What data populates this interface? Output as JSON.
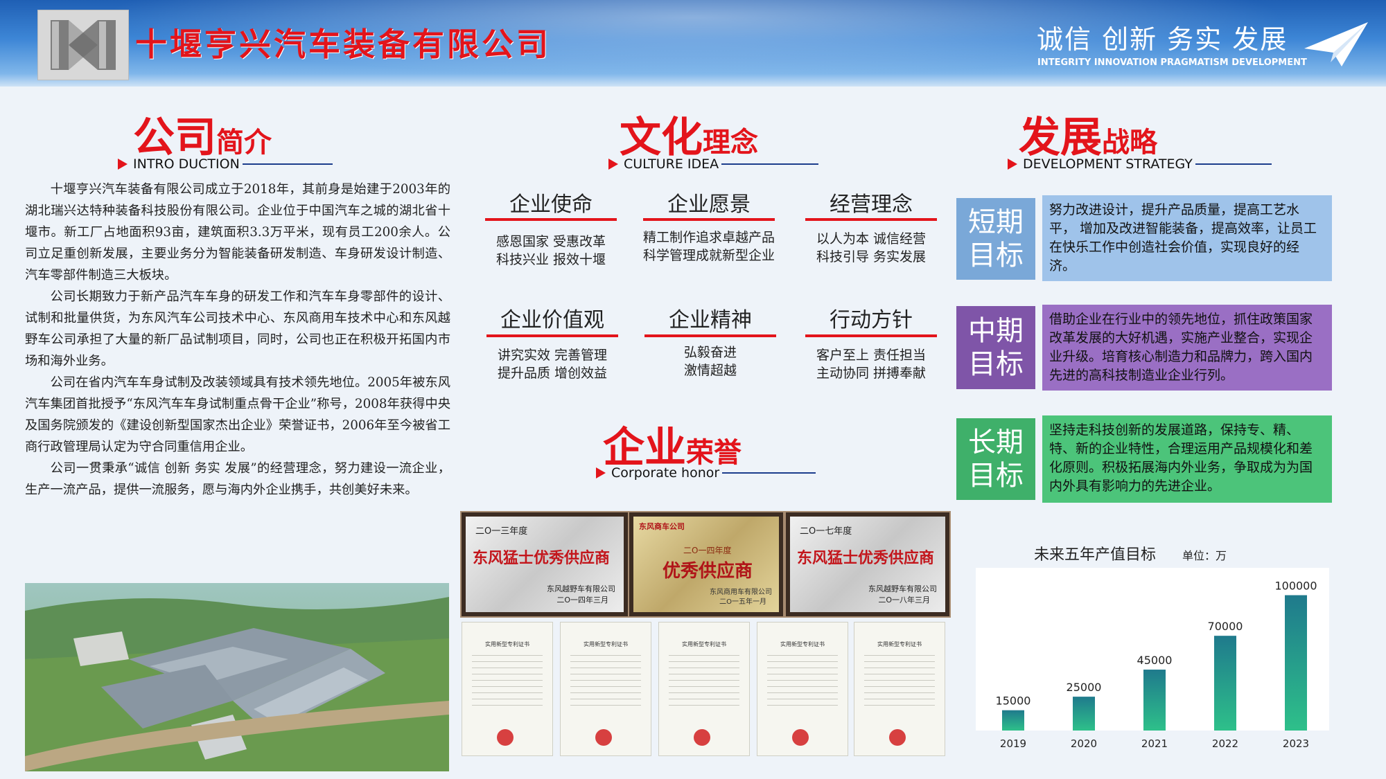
{
  "header": {
    "company_name": "十堰亨兴汽车装备有限公司",
    "motto": "诚信 创新 务实 发展",
    "motto_en": "INTEGRITY INNOVATION PRAGMATISM DEVELOPMENT"
  },
  "intro": {
    "title_big": "公司",
    "title_small": "简介",
    "subtitle": "INTRO DUCTION",
    "paragraphs": [
      "十堰亨兴汽车装备有限公司成立于2018年，其前身是始建于2003年的湖北瑞兴达特种装备科技股份有限公司。企业位于中国汽车之城的湖北省十堰市。新工厂占地面积93亩，建筑面积3.3万平米，现有员工200余人。公司立足重创新发展，主要业务分为智能装备研发制造、车身研发设计制造、汽车零部件制造三大板块。",
      "公司长期致力于新产品汽车车身的研发工作和汽车车身零部件的设计、试制和批量供货，为东风汽车公司技术中心、东风商用车技术中心和东风越野车公司承担了大量的新厂品试制项目，同时，公司也正在积极开拓国内市场和海外业务。",
      "公司在省内汽车车身试制及改装领域具有技术领先地位。2005年被东风汽车集团首批授予“东风汽车车身试制重点骨干企业”称号，2008年获得中央及国务院颁发的《建设创新型国家杰出企业》荣誉证书，2006年至今被省工商行政管理局认定为守合同重信用企业。",
      "公司一贯秉承“诚信 创新 务实 发展”的经营理念，努力建设一流企业，生产一流产品，提供一流服务，愿与海内外企业携手，共创美好未来。"
    ]
  },
  "culture": {
    "title_big": "文化",
    "title_small": "理念",
    "subtitle": "CULTURE IDEA",
    "items": [
      {
        "heading": "企业使命",
        "line1": "感恩国家 受惠改革",
        "line2": "科技兴业 报效十堰"
      },
      {
        "heading": "企业愿景",
        "line1": "精工制作追求卓越产品",
        "line2": "科学管理成就新型企业"
      },
      {
        "heading": "经营理念",
        "line1": "以人为本 诚信经营",
        "line2": "科技引导  务实发展"
      },
      {
        "heading": "企业价值观",
        "line1": "讲究实效  完善管理",
        "line2": "提升品质  增创效益"
      },
      {
        "heading": "企业精神",
        "line1": "弘毅奋进",
        "line2": "激情超越"
      },
      {
        "heading": "行动方针",
        "line1": "客户至上  责任担当",
        "line2": "主动协同  拼搏奉献"
      }
    ]
  },
  "honor": {
    "title_big": "企业",
    "title_small": "荣誉",
    "subtitle": "Corporate honor",
    "plaques": [
      {
        "year": "二O一三年度",
        "title": "东风猛士优秀供应商",
        "org": "东风越野车有限公司",
        "date": "二O一四年三月"
      },
      {
        "year": "二O一四年度",
        "title": "优秀供应商",
        "org": "东风商用车有限公司",
        "date": "二O一五年一月",
        "brand": "东风商车公司"
      },
      {
        "year": "二O一七年度",
        "title": "东风猛士优秀供应商",
        "org": "东风越野车有限公司",
        "date": "二O一八年三月"
      }
    ],
    "cert_title": "实用新型专利证书"
  },
  "strategy": {
    "title_big": "发展",
    "title_small": "战略",
    "subtitle": "DEVELOPMENT STRATEGY",
    "goals": [
      {
        "label_line1": "短期",
        "label_line2": "目标",
        "text": "努力改进设计，提升产品质量，提高工艺水平， 增加及改进智能装备，提高效率，让员工在快乐工作中创造社会价值，实现良好的经济。",
        "label_color": "#7aa8d8",
        "text_bg": "#9fc3ea"
      },
      {
        "label_line1": "中期",
        "label_line2": "目标",
        "text": "借助企业在行业中的领先地位，抓住政策国家改革发展的大好机遇，实施产业整合，实现企业升级。培育核心制造力和品牌力，跨入国内先进的高科技制造业企业行列。",
        "label_color": "#7f55a8",
        "text_bg": "#9a6fc4"
      },
      {
        "label_line1": "长期",
        "label_line2": "目标",
        "text": "坚持走科技创新的发展道路，保持专、精、特、新的企业特性，合理运用产品规模化和差化原则。积极拓展海内外业务，争取成为为国内外具有影响力的先进企业。",
        "label_color": "#3fb06a",
        "text_bg": "#4cc47a"
      }
    ]
  },
  "chart_data": {
    "type": "bar",
    "title": "未来五年产值目标",
    "unit": "单位：万",
    "categories": [
      "2019",
      "2020",
      "2021",
      "2022",
      "2023"
    ],
    "values": [
      15000,
      25000,
      45000,
      70000,
      100000
    ],
    "value_labels": [
      "15000",
      "25000",
      "45000",
      "70000",
      "100000"
    ],
    "ylim": [
      0,
      110000
    ],
    "bar_color_top": "#1f7a8c",
    "bar_color_bottom": "#2ec08a"
  }
}
